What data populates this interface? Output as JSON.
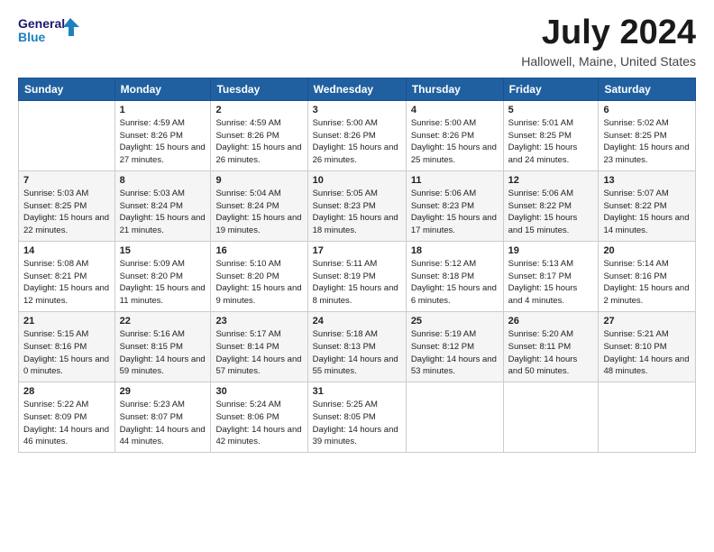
{
  "header": {
    "logo_line1": "General",
    "logo_line2": "Blue",
    "month_year": "July 2024",
    "location": "Hallowell, Maine, United States"
  },
  "weekdays": [
    "Sunday",
    "Monday",
    "Tuesday",
    "Wednesday",
    "Thursday",
    "Friday",
    "Saturday"
  ],
  "weeks": [
    [
      {
        "day": "",
        "sunrise": "",
        "sunset": "",
        "daylight": ""
      },
      {
        "day": "1",
        "sunrise": "Sunrise: 4:59 AM",
        "sunset": "Sunset: 8:26 PM",
        "daylight": "Daylight: 15 hours and 27 minutes."
      },
      {
        "day": "2",
        "sunrise": "Sunrise: 4:59 AM",
        "sunset": "Sunset: 8:26 PM",
        "daylight": "Daylight: 15 hours and 26 minutes."
      },
      {
        "day": "3",
        "sunrise": "Sunrise: 5:00 AM",
        "sunset": "Sunset: 8:26 PM",
        "daylight": "Daylight: 15 hours and 26 minutes."
      },
      {
        "day": "4",
        "sunrise": "Sunrise: 5:00 AM",
        "sunset": "Sunset: 8:26 PM",
        "daylight": "Daylight: 15 hours and 25 minutes."
      },
      {
        "day": "5",
        "sunrise": "Sunrise: 5:01 AM",
        "sunset": "Sunset: 8:25 PM",
        "daylight": "Daylight: 15 hours and 24 minutes."
      },
      {
        "day": "6",
        "sunrise": "Sunrise: 5:02 AM",
        "sunset": "Sunset: 8:25 PM",
        "daylight": "Daylight: 15 hours and 23 minutes."
      }
    ],
    [
      {
        "day": "7",
        "sunrise": "Sunrise: 5:03 AM",
        "sunset": "Sunset: 8:25 PM",
        "daylight": "Daylight: 15 hours and 22 minutes."
      },
      {
        "day": "8",
        "sunrise": "Sunrise: 5:03 AM",
        "sunset": "Sunset: 8:24 PM",
        "daylight": "Daylight: 15 hours and 21 minutes."
      },
      {
        "day": "9",
        "sunrise": "Sunrise: 5:04 AM",
        "sunset": "Sunset: 8:24 PM",
        "daylight": "Daylight: 15 hours and 19 minutes."
      },
      {
        "day": "10",
        "sunrise": "Sunrise: 5:05 AM",
        "sunset": "Sunset: 8:23 PM",
        "daylight": "Daylight: 15 hours and 18 minutes."
      },
      {
        "day": "11",
        "sunrise": "Sunrise: 5:06 AM",
        "sunset": "Sunset: 8:23 PM",
        "daylight": "Daylight: 15 hours and 17 minutes."
      },
      {
        "day": "12",
        "sunrise": "Sunrise: 5:06 AM",
        "sunset": "Sunset: 8:22 PM",
        "daylight": "Daylight: 15 hours and 15 minutes."
      },
      {
        "day": "13",
        "sunrise": "Sunrise: 5:07 AM",
        "sunset": "Sunset: 8:22 PM",
        "daylight": "Daylight: 15 hours and 14 minutes."
      }
    ],
    [
      {
        "day": "14",
        "sunrise": "Sunrise: 5:08 AM",
        "sunset": "Sunset: 8:21 PM",
        "daylight": "Daylight: 15 hours and 12 minutes."
      },
      {
        "day": "15",
        "sunrise": "Sunrise: 5:09 AM",
        "sunset": "Sunset: 8:20 PM",
        "daylight": "Daylight: 15 hours and 11 minutes."
      },
      {
        "day": "16",
        "sunrise": "Sunrise: 5:10 AM",
        "sunset": "Sunset: 8:20 PM",
        "daylight": "Daylight: 15 hours and 9 minutes."
      },
      {
        "day": "17",
        "sunrise": "Sunrise: 5:11 AM",
        "sunset": "Sunset: 8:19 PM",
        "daylight": "Daylight: 15 hours and 8 minutes."
      },
      {
        "day": "18",
        "sunrise": "Sunrise: 5:12 AM",
        "sunset": "Sunset: 8:18 PM",
        "daylight": "Daylight: 15 hours and 6 minutes."
      },
      {
        "day": "19",
        "sunrise": "Sunrise: 5:13 AM",
        "sunset": "Sunset: 8:17 PM",
        "daylight": "Daylight: 15 hours and 4 minutes."
      },
      {
        "day": "20",
        "sunrise": "Sunrise: 5:14 AM",
        "sunset": "Sunset: 8:16 PM",
        "daylight": "Daylight: 15 hours and 2 minutes."
      }
    ],
    [
      {
        "day": "21",
        "sunrise": "Sunrise: 5:15 AM",
        "sunset": "Sunset: 8:16 PM",
        "daylight": "Daylight: 15 hours and 0 minutes."
      },
      {
        "day": "22",
        "sunrise": "Sunrise: 5:16 AM",
        "sunset": "Sunset: 8:15 PM",
        "daylight": "Daylight: 14 hours and 59 minutes."
      },
      {
        "day": "23",
        "sunrise": "Sunrise: 5:17 AM",
        "sunset": "Sunset: 8:14 PM",
        "daylight": "Daylight: 14 hours and 57 minutes."
      },
      {
        "day": "24",
        "sunrise": "Sunrise: 5:18 AM",
        "sunset": "Sunset: 8:13 PM",
        "daylight": "Daylight: 14 hours and 55 minutes."
      },
      {
        "day": "25",
        "sunrise": "Sunrise: 5:19 AM",
        "sunset": "Sunset: 8:12 PM",
        "daylight": "Daylight: 14 hours and 53 minutes."
      },
      {
        "day": "26",
        "sunrise": "Sunrise: 5:20 AM",
        "sunset": "Sunset: 8:11 PM",
        "daylight": "Daylight: 14 hours and 50 minutes."
      },
      {
        "day": "27",
        "sunrise": "Sunrise: 5:21 AM",
        "sunset": "Sunset: 8:10 PM",
        "daylight": "Daylight: 14 hours and 48 minutes."
      }
    ],
    [
      {
        "day": "28",
        "sunrise": "Sunrise: 5:22 AM",
        "sunset": "Sunset: 8:09 PM",
        "daylight": "Daylight: 14 hours and 46 minutes."
      },
      {
        "day": "29",
        "sunrise": "Sunrise: 5:23 AM",
        "sunset": "Sunset: 8:07 PM",
        "daylight": "Daylight: 14 hours and 44 minutes."
      },
      {
        "day": "30",
        "sunrise": "Sunrise: 5:24 AM",
        "sunset": "Sunset: 8:06 PM",
        "daylight": "Daylight: 14 hours and 42 minutes."
      },
      {
        "day": "31",
        "sunrise": "Sunrise: 5:25 AM",
        "sunset": "Sunset: 8:05 PM",
        "daylight": "Daylight: 14 hours and 39 minutes."
      },
      {
        "day": "",
        "sunrise": "",
        "sunset": "",
        "daylight": ""
      },
      {
        "day": "",
        "sunrise": "",
        "sunset": "",
        "daylight": ""
      },
      {
        "day": "",
        "sunrise": "",
        "sunset": "",
        "daylight": ""
      }
    ]
  ]
}
